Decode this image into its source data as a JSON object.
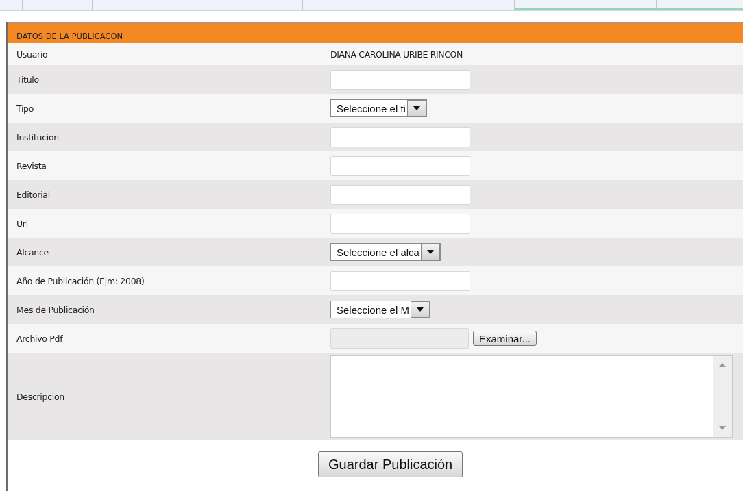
{
  "section": {
    "title": "DATOS DE LA PUBLICACÓN"
  },
  "fields": [
    {
      "label": "Usuario",
      "kind": "text",
      "value": "DIANA CAROLINA URIBE RINCON"
    },
    {
      "label": "Titulo",
      "kind": "input"
    },
    {
      "label": "Tipo",
      "kind": "select",
      "value": "Seleccione el ti"
    },
    {
      "label": "Institucion",
      "kind": "input"
    },
    {
      "label": "Revista",
      "kind": "input"
    },
    {
      "label": "Editorial",
      "kind": "input"
    },
    {
      "label": "Url",
      "kind": "input"
    },
    {
      "label": "Alcance",
      "kind": "select",
      "value": "Seleccione el alca"
    },
    {
      "label": "Año de Publicación (Ejm: 2008)",
      "kind": "input"
    },
    {
      "label": "Mes de Publicación",
      "kind": "select",
      "value": "Seleccione el M"
    },
    {
      "label": "Archivo Pdf",
      "kind": "file",
      "button": "Examinar..."
    },
    {
      "label": "Descripcion",
      "kind": "textarea"
    }
  ],
  "submit": "Guardar Publicación"
}
